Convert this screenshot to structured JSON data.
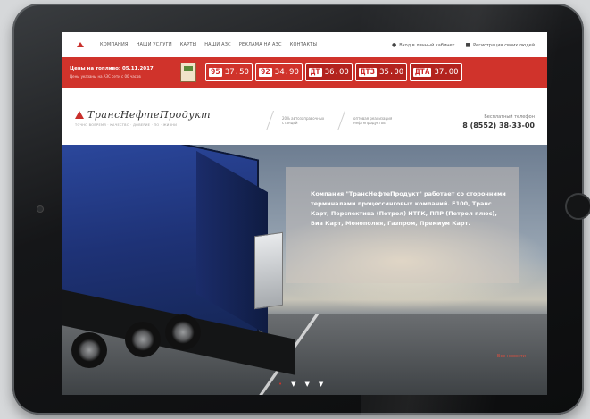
{
  "nav": {
    "items": [
      "КОМПАНИЯ",
      "НАШИ УСЛУГИ",
      "КАРТЫ",
      "НАШИ АЗС",
      "РЕКЛАМА НА АЗС",
      "КОНТАКТЫ"
    ],
    "user_entry": "Вход в личный кабинет",
    "user_reg": "Регистрация своих людей"
  },
  "redbar": {
    "date_label": "Цены на топливо: 05.11.2017",
    "note": "Цены указаны на АЗС сети с 00 часов",
    "prices": [
      {
        "fuel": "95",
        "value": "37.50",
        "dark": false
      },
      {
        "fuel": "92",
        "value": "34.90",
        "dark": false
      },
      {
        "fuel": "ДТ",
        "value": "36.00",
        "dark": true
      },
      {
        "fuel": "ДТЗ",
        "value": "35.00",
        "dark": true
      },
      {
        "fuel": "ДТА",
        "value": "37.00",
        "dark": true
      }
    ]
  },
  "brand": {
    "name": "ТрансНефтеПродукт",
    "slogan": "ТОЧНО ВОВРЕМЯ · КАЧЕСТВО · ДОВЕРИЕ · ПО · ЖИЗНИ",
    "stat1": "20% автозаправочных станций",
    "stat2": "оптовая реализация нефтепродуктов",
    "phone_label": "Бесплатный телефон",
    "phone": "8 (8552) 38-33-00"
  },
  "hero": {
    "text": "Компания \"ТрансНефтеПродукт\" работает со сторонними терминалами процессинговых компаний. Е100, Транс Карт, Перспектива (Петрол) НТГК, ППР (Петрол плюс), Виа Карт, Монополия, Газпром, Премиум Карт.",
    "corner_link": "Все новости",
    "dots": [
      "•",
      "▼",
      "▼",
      "▼"
    ]
  },
  "colors": {
    "accent": "#d0332b"
  }
}
